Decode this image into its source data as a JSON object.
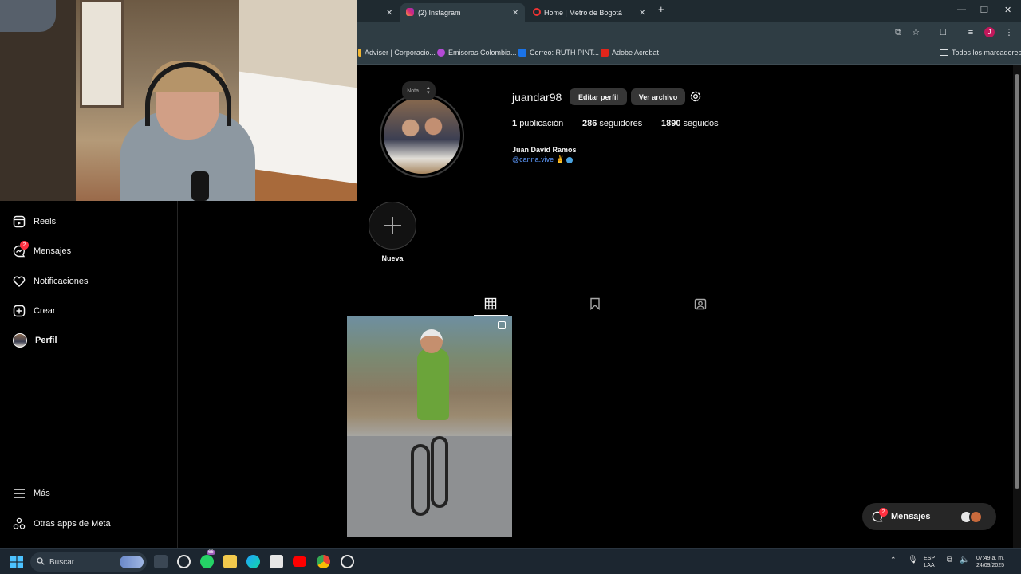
{
  "browser": {
    "tabs": [
      {
        "label": "(2) Instagram",
        "active": true
      },
      {
        "label": "Home | Metro de Bogotá",
        "active": false
      }
    ],
    "bookmarks": [
      "Adviser | Corporacio...",
      "Emisoras Colombia...",
      "Correo: RUTH PINT...",
      "Adobe Acrobat"
    ],
    "all_bookmarks": "Todos los marcadores",
    "profile_initial": "J"
  },
  "sidebar": {
    "items": [
      {
        "label": "Reels",
        "icon": "reels-icon"
      },
      {
        "label": "Mensajes",
        "icon": "messenger-icon",
        "badge": "2"
      },
      {
        "label": "Notificaciones",
        "icon": "heart-icon"
      },
      {
        "label": "Crear",
        "icon": "create-plus-icon"
      },
      {
        "label": "Perfil",
        "icon": "profile-avatar-icon"
      }
    ],
    "more": "Más",
    "meta_apps": "Otras apps de Meta"
  },
  "profile": {
    "note": "Nota...",
    "username": "juandar98",
    "edit_button": "Editar perfil",
    "archive_button": "Ver archivo",
    "posts_count": "1",
    "posts_label": "publicación",
    "followers_count": "286",
    "followers_label": "seguidores",
    "following_count": "1890",
    "following_label": "seguidos",
    "full_name": "Juan David Ramos",
    "bio_handle": "@canna.vive",
    "highlight_new": "Nueva"
  },
  "messages_pill": {
    "label": "Mensajes",
    "badge": "2"
  },
  "taskbar": {
    "search_placeholder": "Buscar",
    "whatsapp_badge": "66",
    "lang_top": "ESP",
    "lang_bottom": "LAA",
    "time": "07:49 a. m.",
    "date": "24/09/2025"
  },
  "colors": {
    "accent_link": "#5e9bff",
    "badge": "#ff3040",
    "background": "#000000",
    "button": "#363636"
  }
}
